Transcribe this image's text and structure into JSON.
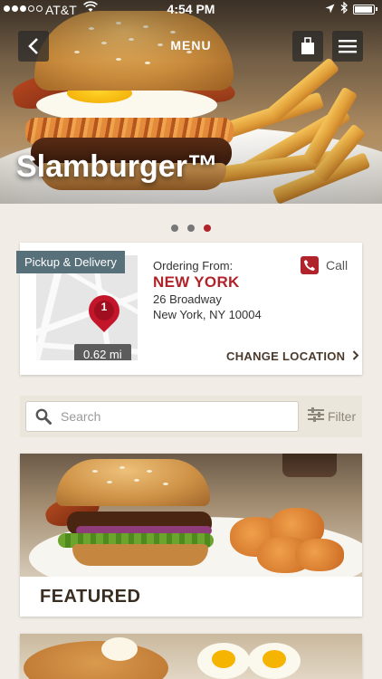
{
  "status_bar": {
    "carrier": "AT&T",
    "time": "4:54 PM",
    "battery_level": 0.95
  },
  "nav": {
    "menu_label": "MENU"
  },
  "hero": {
    "title": "Slamburger™"
  },
  "carousel": {
    "page_count": 3,
    "active_index": 2
  },
  "location": {
    "pickup_tag": "Pickup & Delivery",
    "pin_number": "1",
    "distance": "0.62 mi",
    "ordering_label": "Ordering From:",
    "city": "NEW YORK",
    "address_line1": "26 Broadway",
    "address_line2": "New York, NY 10004",
    "call_label": "Call",
    "change_location_label": "CHANGE LOCATION"
  },
  "search": {
    "placeholder": "Search",
    "filter_label": "Filter"
  },
  "featured": {
    "title": "FEATURED"
  },
  "colors": {
    "accent": "#b0232a",
    "tag": "#58707a",
    "background": "#f1ede6"
  }
}
